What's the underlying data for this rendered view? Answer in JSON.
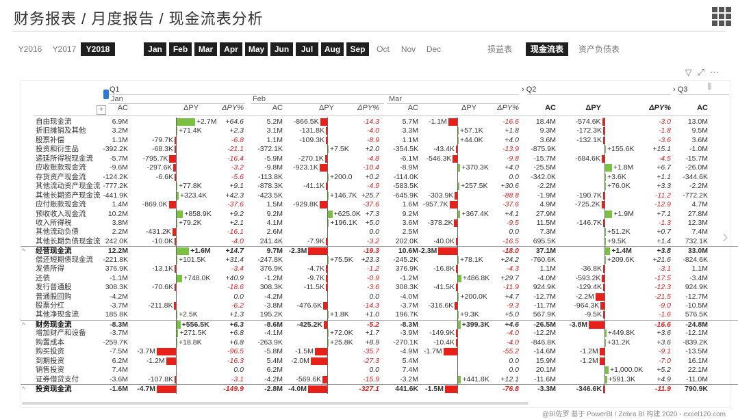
{
  "title": "财务报表 / 月度报告 / 现金流表分析",
  "years": [
    {
      "label": "Y2016",
      "active": false
    },
    {
      "label": "Y2017",
      "active": false
    },
    {
      "label": "Y2018",
      "active": true
    }
  ],
  "months": [
    {
      "label": "Jan",
      "active": true
    },
    {
      "label": "Feb",
      "active": true
    },
    {
      "label": "Mar",
      "active": true
    },
    {
      "label": "Apr",
      "active": true
    },
    {
      "label": "May",
      "active": true
    },
    {
      "label": "Jun",
      "active": true
    },
    {
      "label": "Jul",
      "active": true
    },
    {
      "label": "Aug",
      "active": true
    },
    {
      "label": "Sep",
      "active": true
    },
    {
      "label": "Oct",
      "active": false
    },
    {
      "label": "Nov",
      "active": false
    },
    {
      "label": "Dec",
      "active": false
    }
  ],
  "reports": [
    {
      "label": "损益表",
      "active": false
    },
    {
      "label": "现金流表",
      "active": true
    },
    {
      "label": "资产负债表",
      "active": false
    }
  ],
  "quarters": {
    "q1": "Q1",
    "q2": "Q2",
    "q3": "Q3"
  },
  "month_headers": [
    "Jan",
    "Feb",
    "Mar"
  ],
  "columns": {
    "ac": "AC",
    "dpy": "ΔPY",
    "dpyp": "ΔPY%"
  },
  "expand_label": "+",
  "footer": "@BI佐罗 基于 PowerBI / Zebra BI 构建 2020 - excel120.com",
  "colors": {
    "positive": "#7ac143",
    "negative": "#e8201a",
    "active_bg": "#1f1f1f"
  },
  "rows": [
    {
      "label": "自由现金流",
      "sub": false,
      "jan": [
        "6.9M",
        "+2.7M",
        "+64.6"
      ],
      "feb": [
        "5.2M",
        "-866.5K",
        "-14.3"
      ],
      "mar": [
        "5.7M",
        "-1.1M",
        "-16.6"
      ],
      "q2": [
        "18.4M",
        "-574.6K",
        "-3.0"
      ],
      "q3": [
        "13.0M"
      ]
    },
    {
      "label": "折旧摊销及其他",
      "sub": false,
      "jan": [
        "3.2M",
        "+71.4K",
        "+2.3"
      ],
      "feb": [
        "3.1M",
        "-131.8K",
        "-4.0"
      ],
      "mar": [
        "3.3M",
        "+57.1K",
        "+1.8"
      ],
      "q2": [
        "9.3M",
        "-172.3K",
        "-1.8"
      ],
      "q3": [
        "9.5M"
      ]
    },
    {
      "label": "股票补偿",
      "sub": false,
      "jan": [
        "1.1M",
        "-79.7K",
        "-6.8"
      ],
      "feb": [
        "1.1M",
        "-109.3K",
        "-8.9"
      ],
      "mar": [
        "1.1M",
        "+44.0K",
        "+4.0"
      ],
      "q2": [
        "3.6M",
        "-132.1K",
        "-3.6"
      ],
      "q3": [
        "3.6M"
      ]
    },
    {
      "label": "投资和衍生品",
      "sub": false,
      "jan": [
        "-392.2K",
        "-68.3K",
        "-21.1"
      ],
      "feb": [
        "-372.1K",
        "+7.5K",
        "+2.0"
      ],
      "mar": [
        "-354.5K",
        "-43.4K",
        "-13.9"
      ],
      "q2": [
        "-875.9K",
        "+155.6K",
        "+15.1"
      ],
      "q3": [
        "-1.0M"
      ]
    },
    {
      "label": "递延所得税现金流",
      "sub": false,
      "jan": [
        "-5.7M",
        "-795.7K",
        "-16.4"
      ],
      "feb": [
        "-5.9M",
        "-270.1K",
        "-4.8"
      ],
      "mar": [
        "-6.1M",
        "-546.3K",
        "-9.8"
      ],
      "q2": [
        "-15.7M",
        "-684.6K",
        "-4.5"
      ],
      "q3": [
        "-15.7M"
      ]
    },
    {
      "label": "应收账款现金流",
      "sub": false,
      "jan": [
        "-9.6M",
        "-297.6K",
        "-3.2"
      ],
      "feb": [
        "-9.8M",
        "-923.1K",
        "-10.4"
      ],
      "mar": [
        "-8.9M",
        "+370.3K",
        "+4.0"
      ],
      "q2": [
        "-25.5M",
        "+1.8M",
        "+6.7"
      ],
      "q3": [
        "-26.0M"
      ]
    },
    {
      "label": "存货资产现金流",
      "sub": false,
      "jan": [
        "-124.2K",
        "-6.6K",
        "-5.6"
      ],
      "feb": [
        "-113.8K",
        "+200.0",
        "+0.2"
      ],
      "mar": [
        "-114.0K",
        "",
        "0.0"
      ],
      "q2": [
        "-342.0K",
        "+3.6K",
        "+1.1"
      ],
      "q3": [
        "-344.6K"
      ]
    },
    {
      "label": "其他流动资产现金流",
      "sub": false,
      "jan": [
        "-777.2K",
        "+77.8K",
        "+9.1"
      ],
      "feb": [
        "-878.3K",
        "-41.1K",
        "-4.9"
      ],
      "mar": [
        "-583.5K",
        "+257.5K",
        "+30.6"
      ],
      "q2": [
        "-2.2M",
        "+76.0K",
        "+3.3"
      ],
      "q3": [
        "-2.2M"
      ]
    },
    {
      "label": "其他长期资产现金流",
      "sub": false,
      "jan": [
        "-441.9K",
        "+323.4K",
        "+42.3"
      ],
      "feb": [
        "-423.5K",
        "+146.7K",
        "+25.7"
      ],
      "mar": [
        "-645.9K",
        "-303.9K",
        "-88.8"
      ],
      "q2": [
        "-1.9M",
        "-190.7K",
        "-11.2"
      ],
      "q3": [
        "-772.2K"
      ]
    },
    {
      "label": "应付账款现金流",
      "sub": false,
      "jan": [
        "1.4M",
        "-869.0K",
        "-37.6"
      ],
      "feb": [
        "1.5M",
        "-929.8K",
        "-37.6"
      ],
      "mar": [
        "1.6M",
        "-957.7K",
        "-37.6"
      ],
      "q2": [
        "4.9M",
        "-725.2K",
        "-12.9"
      ],
      "q3": [
        "4.7M"
      ]
    },
    {
      "label": "预收收入现金流",
      "sub": false,
      "jan": [
        "10.2M",
        "+858.9K",
        "+9.2"
      ],
      "feb": [
        "9.2M",
        "+625.0K",
        "+7.3"
      ],
      "mar": [
        "9.2M",
        "+367.4K",
        "+4.1"
      ],
      "q2": [
        "27.9M",
        "+1.9M",
        "+7.1"
      ],
      "q3": [
        "27.8M"
      ]
    },
    {
      "label": "收入所得税",
      "sub": false,
      "jan": [
        "3.8M",
        "+79.2K",
        "+2.1"
      ],
      "feb": [
        "4.1M",
        "+196.1K",
        "+5.0"
      ],
      "mar": [
        "3.6M",
        "-378.2K",
        "-9.5"
      ],
      "q2": [
        "11.5M",
        "-146.7K",
        "-1.3"
      ],
      "q3": [
        "12.3M"
      ]
    },
    {
      "label": "其他流动负债",
      "sub": false,
      "jan": [
        "2.2M",
        "-431.2K",
        "-16.1"
      ],
      "feb": [
        "2.6M",
        "",
        "0.0"
      ],
      "mar": [
        "2.5M",
        "",
        "0.0"
      ],
      "q2": [
        "7.3M",
        "+51.2K",
        "+0.7"
      ],
      "q3": [
        "7.4M"
      ]
    },
    {
      "label": "其他长期负债现金流",
      "sub": false,
      "jan": [
        "242.0K",
        "-10.0K",
        "-4.0"
      ],
      "feb": [
        "241.4K",
        "-7.9K",
        "-3.2"
      ],
      "mar": [
        "202.0K",
        "-40.0K",
        "-16.5"
      ],
      "q2": [
        "695.5K",
        "+9.5K",
        "+1.4"
      ],
      "q3": [
        "732.1K"
      ]
    },
    {
      "label": "经营现金流",
      "sub": true,
      "jan": [
        "12.2M",
        "+1.6M",
        "+14.7"
      ],
      "feb": [
        "9.7M",
        "-2.3M",
        "-19.3"
      ],
      "mar": [
        "10.6M",
        "-2.3M",
        "-18.0"
      ],
      "q2": [
        "37.1M",
        "+1.4M",
        "+3.8"
      ],
      "q3": [
        "33.0M"
      ]
    },
    {
      "label": "偿还短期债现金流",
      "sub": false,
      "jan": [
        "-221.8K",
        "+101.5K",
        "+31.4"
      ],
      "feb": [
        "-247.8K",
        "+75.5K",
        "+23.3"
      ],
      "mar": [
        "-245.2K",
        "+78.1K",
        "+24.2"
      ],
      "q2": [
        "-760.6K",
        "+209.6K",
        "+21.6"
      ],
      "q3": [
        "-824.6K"
      ]
    },
    {
      "label": "发债所得",
      "sub": false,
      "jan": [
        "376.9K",
        "-13.1K",
        "-3.4"
      ],
      "feb": [
        "376.9K",
        "-4.7K",
        "-1.2"
      ],
      "mar": [
        "376.9K",
        "-16.8K",
        "-4.3"
      ],
      "q2": [
        "1.1M",
        "-36.8K",
        "-3.1"
      ],
      "q3": [
        "1.1M"
      ]
    },
    {
      "label": "还债",
      "sub": false,
      "jan": [
        "-1.1M",
        "+748.0K",
        "+40.9"
      ],
      "feb": [
        "-1.2M",
        "-9.7K",
        "-0.9"
      ],
      "mar": [
        "-1.2M",
        "+486.8K",
        "+29.7"
      ],
      "q2": [
        "-4.0M",
        "-593.2K",
        "-17.5"
      ],
      "q3": [
        "-3.4M"
      ]
    },
    {
      "label": "发行普通股",
      "sub": false,
      "jan": [
        "308.3K",
        "-70.6K",
        "-18.6"
      ],
      "feb": [
        "308.3K",
        "-11.5K",
        "-3.6"
      ],
      "mar": [
        "308.3K",
        "-41.5K",
        "-11.9"
      ],
      "q2": [
        "924.9K",
        "-129.4K",
        "-12.3"
      ],
      "q3": [
        "924.9K"
      ]
    },
    {
      "label": "普通股回购",
      "sub": false,
      "jan": [
        "-4.2M",
        "",
        "0.0"
      ],
      "feb": [
        "-4.2M",
        "",
        "0.0"
      ],
      "mar": [
        "-4.0M",
        "+200.0K",
        "+4.7"
      ],
      "q2": [
        "-12.7M",
        "-2.2M",
        "-21.5"
      ],
      "q3": [
        "-12.7M"
      ]
    },
    {
      "label": "股票分红",
      "sub": false,
      "jan": [
        "-3.7M",
        "-211.8K",
        "-6.2"
      ],
      "feb": [
        "-3.8M",
        "-476.6K",
        "-14.3"
      ],
      "mar": [
        "-3.7M",
        "-316.6K",
        "-9.3"
      ],
      "q2": [
        "-11.7M",
        "-964.3K",
        "-9.0"
      ],
      "q3": [
        "-10.5M"
      ]
    },
    {
      "label": "其他净现金流",
      "sub": false,
      "jan": [
        "185.8K",
        "+2.5K",
        "+1.3"
      ],
      "feb": [
        "195.2K",
        "+1.8K",
        "+1.0"
      ],
      "mar": [
        "196.7K",
        "+9.3K",
        "+5.0"
      ],
      "q2": [
        "567.9K",
        "-9.5K",
        "-1.6"
      ],
      "q3": [
        "576.5K"
      ]
    },
    {
      "label": "财务现金流",
      "sub": true,
      "jan": [
        "-8.3M",
        "+556.5K",
        "+6.3"
      ],
      "feb": [
        "-8.6M",
        "-425.2K",
        "-5.2"
      ],
      "mar": [
        "-8.3M",
        "+399.3K",
        "+4.6"
      ],
      "q2": [
        "-26.5M",
        "-3.8M",
        "-16.6"
      ],
      "q3": [
        "-24.8M"
      ]
    },
    {
      "label": "增加财产和设备",
      "sub": false,
      "jan": [
        "-3.7M",
        "+271.5K",
        "+6.8"
      ],
      "feb": [
        "-4.1M",
        "+72.0K",
        "+1.7"
      ],
      "mar": [
        "-3.9M",
        "-149.9K",
        "-4.0"
      ],
      "q2": [
        "-12.2M",
        "+449.8K",
        "+3.6"
      ],
      "q3": [
        "-12.1M"
      ]
    },
    {
      "label": "购置成本",
      "sub": false,
      "jan": [
        "-259.7K",
        "+18.8K",
        "+6.8"
      ],
      "feb": [
        "-263.9K",
        "+25.8K",
        "+8.9"
      ],
      "mar": [
        "-270.1K",
        "-10.4K",
        "-4.0"
      ],
      "q2": [
        "-846.8K",
        "+31.2K",
        "+3.6"
      ],
      "q3": [
        "-839.2K"
      ]
    },
    {
      "label": "购买投资",
      "sub": false,
      "jan": [
        "-7.5M",
        "-3.7M",
        "-96.5"
      ],
      "feb": [
        "-5.8M",
        "-1.5M",
        "-35.7"
      ],
      "mar": [
        "-4.9M",
        "-1.7M",
        "-55.2"
      ],
      "q2": [
        "-14.6M",
        "-1.2M",
        "-9.1"
      ],
      "q3": [
        "-13.5M"
      ]
    },
    {
      "label": "到期投资",
      "sub": false,
      "jan": [
        "6.2M",
        "-1.2M",
        "-16.3"
      ],
      "feb": [
        "5.4M",
        "-2.0M",
        "-27.3"
      ],
      "mar": [
        "5.4M",
        "",
        "0.0"
      ],
      "q2": [
        "15.9M",
        "-1.2M",
        "-7.0"
      ],
      "q3": [
        "16.1M"
      ]
    },
    {
      "label": "销售投资",
      "sub": false,
      "jan": [
        "7.4M",
        "",
        "0.0"
      ],
      "feb": [
        "6.2M",
        "",
        "0.0"
      ],
      "mar": [
        "7.4M",
        "",
        "0.0"
      ],
      "q2": [
        "20.1M",
        "+1,000.0K",
        "+5.2"
      ],
      "q3": [
        "22.1M"
      ]
    },
    {
      "label": "证券借贷支付",
      "sub": false,
      "jan": [
        "-3.6M",
        "-107.8K",
        "-3.1"
      ],
      "feb": [
        "-4.2M",
        "-569.6K",
        "-15.9"
      ],
      "mar": [
        "-3.2M",
        "+441.8K",
        "+12.1"
      ],
      "q2": [
        "-11.6M",
        "+591.3K",
        "+4.9"
      ],
      "q3": [
        "-11.0M"
      ]
    },
    {
      "label": "投资现金流",
      "sub": true,
      "jan": [
        "-1.6M",
        "-4.7M",
        "-149.9"
      ],
      "feb": [
        "-2.8M",
        "-4.0M",
        "-327.1"
      ],
      "mar": [
        "441.6K",
        "-1.5M",
        "-76.8"
      ],
      "q2": [
        "-3.3M",
        "-346.6K",
        "-11.9"
      ],
      "q3": [
        "790.9K"
      ]
    }
  ]
}
